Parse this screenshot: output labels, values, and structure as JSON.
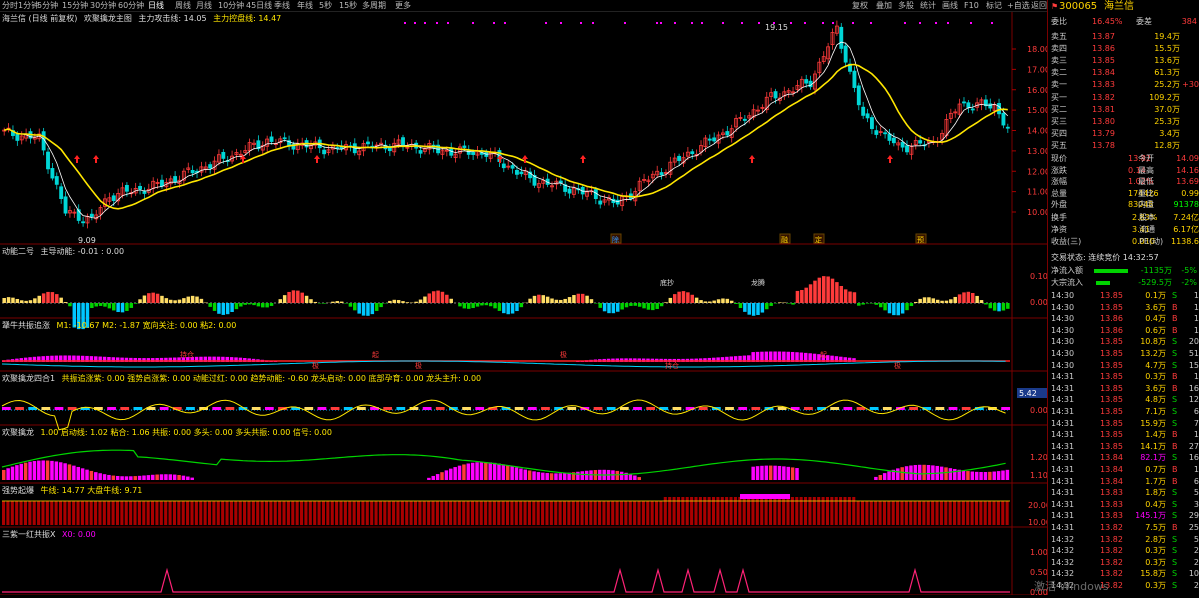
{
  "topbar": {
    "tabs": [
      "分时",
      "1分钟",
      "5分钟",
      "15分钟",
      "30分钟",
      "60分钟",
      "日线",
      "周线",
      "月线",
      "10分钟",
      "45日线",
      "季线",
      "年线",
      "5秒",
      "15秒",
      "多周期",
      "更多"
    ],
    "active_tab": "日线",
    "right_buttons": [
      "复权",
      "叠加",
      "多股",
      "统计",
      "画线",
      "F10",
      "标记",
      "+自选",
      "返回"
    ]
  },
  "main_panel": {
    "title": "海兰信 (日线 前复权)",
    "indicator": "欢聚擒龙主图",
    "line1": "主力攻击线: 14.05",
    "line2": "主力控盘线: 14.47",
    "y_ticks": [
      "18.00",
      "17.00",
      "16.00",
      "15.00",
      "14.00",
      "13.00",
      "12.00",
      "11.00",
      "10.00"
    ],
    "high_label": "19.15",
    "low_label": "9.09",
    "event_tags": [
      "除",
      "融",
      "定",
      "预"
    ]
  },
  "sub_panels": [
    {
      "name": "动能二号",
      "fields": "主导动能: -0.01 : 0.00",
      "y_ticks": [
        "0.10",
        "0.00"
      ],
      "labels": [
        "底抄",
        "龙腾"
      ]
    },
    {
      "name": "犟牛共振追涨",
      "fields": "M1: -10.67  M2: -1.87  宽向关注: 0.00  粘2: 0.00",
      "y_ticks": [],
      "labels": [
        "持仓",
        "极",
        "起",
        "极",
        "极",
        "持仓",
        "起",
        "极"
      ]
    },
    {
      "name": "欢聚擒龙四合1",
      "fields": "共振追涨紫: 0.00  强势启涨紫: 0.00  动能过红: 0.00  趋势动能: -0.60  龙头启动: 0.00  底部孕育: 0.00  龙头主升: 0.00",
      "y_ticks": [
        "0.00"
      ],
      "value_tag": "5.42"
    },
    {
      "name": "欢聚擒龙",
      "fields": "1.00  启动线: 1.02  粘合: 1.06  共振: 0.00  多头: 0.00  多头共振: 0.00  信号: 0.00",
      "y_ticks": [
        "1.20",
        "1.10"
      ]
    },
    {
      "name": "强势起爆",
      "fields": "牛线: 14.77  大盘牛线: 9.71",
      "y_ticks": [
        "20.00",
        "10.00"
      ]
    },
    {
      "name": "三紫一红共振X",
      "fields": "X0: 0.00",
      "y_ticks": [
        "1.00",
        "0.50",
        "0.00"
      ]
    }
  ],
  "quote": {
    "code": "300065",
    "name": "海兰信",
    "weibi_label": "委比",
    "weibi": "16.45%",
    "weicha_label": "委差",
    "weicha": "384",
    "asks": [
      {
        "label": "卖五",
        "price": "13.87",
        "vol": "19.4万"
      },
      {
        "label": "卖四",
        "price": "13.86",
        "vol": "15.5万"
      },
      {
        "label": "卖三",
        "price": "13.85",
        "vol": "13.6万"
      },
      {
        "label": "卖二",
        "price": "13.84",
        "vol": "61.3万"
      },
      {
        "label": "卖一",
        "price": "13.83",
        "vol": "25.2万",
        "extra": "+30"
      }
    ],
    "bids": [
      {
        "label": "买一",
        "price": "13.82",
        "vol": "109.2万"
      },
      {
        "label": "买二",
        "price": "13.81",
        "vol": "37.0万"
      },
      {
        "label": "买三",
        "price": "13.80",
        "vol": "25.3万"
      },
      {
        "label": "买四",
        "price": "13.79",
        "vol": "3.4万"
      },
      {
        "label": "买五",
        "price": "13.78",
        "vol": "12.8万"
      }
    ],
    "stats": [
      {
        "l1": "现价",
        "v1": "13.82",
        "l2": "今开",
        "v2": "14.09"
      },
      {
        "l1": "涨跌",
        "v1": "0.14",
        "l2": "最高",
        "v2": "14.16"
      },
      {
        "l1": "涨幅",
        "v1": "1.02%",
        "l2": "最低",
        "v2": "13.69"
      },
      {
        "l1": "总量",
        "v1": "174426",
        "l2": "量比",
        "v2": "0.99"
      },
      {
        "l1": "外盘",
        "v1": "83048",
        "l2": "内盘",
        "v2": "91378"
      }
    ],
    "stats2": [
      {
        "l1": "换手",
        "v1": "2.83%",
        "l2": "股本",
        "v2": "7.24亿"
      },
      {
        "l1": "净资",
        "v1": "3.41",
        "l2": "流通",
        "v2": "6.17亿"
      },
      {
        "l1": "收益(三)",
        "v1": "0.010",
        "l2": "PE(动)",
        "v2": "1138.6"
      }
    ],
    "trade_state": "交易状态: 连续竞价 14:32:57",
    "inflow": [
      {
        "label": "净流入额",
        "val": "-1135万",
        "pct": "-5%"
      },
      {
        "label": "大宗流入",
        "val": "-529.5万",
        "pct": "-2%"
      }
    ],
    "ticks": [
      [
        "14:30",
        "13.85",
        "0.1万",
        "S",
        "1"
      ],
      [
        "14:30",
        "13.85",
        "3.6万",
        "B",
        "1"
      ],
      [
        "14:30",
        "13.86",
        "0.4万",
        "B",
        "1"
      ],
      [
        "14:30",
        "13.86",
        "0.6万",
        "B",
        "1"
      ],
      [
        "14:30",
        "13.85",
        "10.8万",
        "S",
        "20"
      ],
      [
        "14:30",
        "13.85",
        "13.2万",
        "S",
        "51"
      ],
      [
        "14:30",
        "13.85",
        "4.7万",
        "S",
        "15"
      ],
      [
        "14:31",
        "13.85",
        "0.3万",
        "B",
        "1"
      ],
      [
        "14:31",
        "13.85",
        "3.6万",
        "B",
        "16"
      ],
      [
        "14:31",
        "13.85",
        "4.8万",
        "S",
        "12"
      ],
      [
        "14:31",
        "13.85",
        "7.1万",
        "S",
        "6"
      ],
      [
        "14:31",
        "13.85",
        "15.9万",
        "S",
        "7"
      ],
      [
        "14:31",
        "13.85",
        "1.4万",
        "B",
        "1"
      ],
      [
        "14:31",
        "13.85",
        "14.1万",
        "B",
        "27"
      ],
      [
        "14:31",
        "13.84",
        "82.1万",
        "S",
        "16"
      ],
      [
        "14:31",
        "13.84",
        "0.7万",
        "B",
        "1"
      ],
      [
        "14:31",
        "13.84",
        "1.7万",
        "B",
        "6"
      ],
      [
        "14:31",
        "13.83",
        "1.8万",
        "S",
        "5"
      ],
      [
        "14:31",
        "13.83",
        "0.4万",
        "S",
        "3"
      ],
      [
        "14:31",
        "13.83",
        "145.1万",
        "S",
        "29"
      ],
      [
        "14:31",
        "13.82",
        "7.5万",
        "B",
        "25"
      ],
      [
        "14:32",
        "13.82",
        "2.8万",
        "S",
        "5"
      ],
      [
        "14:32",
        "13.82",
        "0.3万",
        "S",
        "2"
      ],
      [
        "14:32",
        "13.82",
        "0.3万",
        "S",
        "2"
      ],
      [
        "14:32",
        "13.82",
        "15.8万",
        "S",
        "10"
      ],
      [
        "14:32",
        "13.82",
        "0.3万",
        "S",
        "2"
      ]
    ]
  },
  "watermark": "激活 Windows",
  "colors": {
    "up": "#ff3b3b",
    "down": "#00d6d6",
    "ma_yellow": "#ffe600",
    "bg": "#000000",
    "grid": "#7a0000",
    "magenta": "#ff00ff"
  }
}
